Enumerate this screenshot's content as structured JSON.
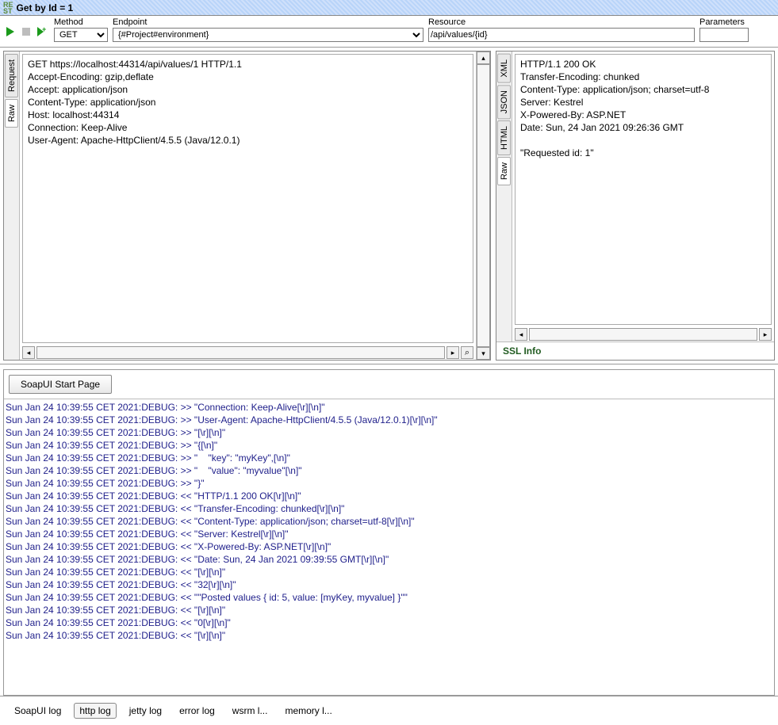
{
  "window": {
    "badge_top": "RE",
    "badge_bot": "ST",
    "title": "Get by Id = 1"
  },
  "toolbar": {
    "method_label": "Method",
    "method_value": "GET",
    "endpoint_label": "Endpoint",
    "endpoint_value": "{#Project#environment}",
    "resource_label": "Resource",
    "resource_value": "/api/values/{id}",
    "parameters_label": "Parameters",
    "parameters_value": ""
  },
  "request": {
    "tabs": [
      "Request",
      "Raw"
    ],
    "raw": "GET https://localhost:44314/api/values/1 HTTP/1.1\nAccept-Encoding: gzip,deflate\nAccept: application/json\nContent-Type: application/json\nHost: localhost:44314\nConnection: Keep-Alive\nUser-Agent: Apache-HttpClient/4.5.5 (Java/12.0.1)"
  },
  "response": {
    "tabs": [
      "XML",
      "JSON",
      "HTML",
      "Raw"
    ],
    "raw": "HTTP/1.1 200 OK\nTransfer-Encoding: chunked\nContent-Type: application/json; charset=utf-8\nServer: Kestrel\nX-Powered-By: ASP.NET\nDate: Sun, 24 Jan 2021 09:26:36 GMT\n\n\"Requested id: 1\"",
    "ssl_info": "SSL Info"
  },
  "startpage_btn": "SoapUI Start Page",
  "log": [
    "Sun Jan 24 10:39:55 CET 2021:DEBUG: >> \"Connection: Keep-Alive[\\r][\\n]\"",
    "Sun Jan 24 10:39:55 CET 2021:DEBUG: >> \"User-Agent: Apache-HttpClient/4.5.5 (Java/12.0.1)[\\r][\\n]\"",
    "Sun Jan 24 10:39:55 CET 2021:DEBUG: >> \"[\\r][\\n]\"",
    "Sun Jan 24 10:39:55 CET 2021:DEBUG: >> \"{[\\n]\"",
    "Sun Jan 24 10:39:55 CET 2021:DEBUG: >> \"    \"key\": \"myKey\",[\\n]\"",
    "Sun Jan 24 10:39:55 CET 2021:DEBUG: >> \"    \"value\": \"myvalue\"[\\n]\"",
    "Sun Jan 24 10:39:55 CET 2021:DEBUG: >> \"}\"",
    "Sun Jan 24 10:39:55 CET 2021:DEBUG: << \"HTTP/1.1 200 OK[\\r][\\n]\"",
    "Sun Jan 24 10:39:55 CET 2021:DEBUG: << \"Transfer-Encoding: chunked[\\r][\\n]\"",
    "Sun Jan 24 10:39:55 CET 2021:DEBUG: << \"Content-Type: application/json; charset=utf-8[\\r][\\n]\"",
    "Sun Jan 24 10:39:55 CET 2021:DEBUG: << \"Server: Kestrel[\\r][\\n]\"",
    "Sun Jan 24 10:39:55 CET 2021:DEBUG: << \"X-Powered-By: ASP.NET[\\r][\\n]\"",
    "Sun Jan 24 10:39:55 CET 2021:DEBUG: << \"Date: Sun, 24 Jan 2021 09:39:55 GMT[\\r][\\n]\"",
    "Sun Jan 24 10:39:55 CET 2021:DEBUG: << \"[\\r][\\n]\"",
    "Sun Jan 24 10:39:55 CET 2021:DEBUG: << \"32[\\r][\\n]\"",
    "Sun Jan 24 10:39:55 CET 2021:DEBUG: << \"\"Posted values { id: 5, value: [myKey, myvalue] }\"\"",
    "Sun Jan 24 10:39:55 CET 2021:DEBUG: << \"[\\r][\\n]\"",
    "Sun Jan 24 10:39:55 CET 2021:DEBUG: << \"0[\\r][\\n]\"",
    "Sun Jan 24 10:39:55 CET 2021:DEBUG: << \"[\\r][\\n]\""
  ],
  "footer_tabs": [
    "SoapUI log",
    "http log",
    "jetty log",
    "error log",
    "wsrm l...",
    "memory l..."
  ],
  "footer_active_index": 1
}
